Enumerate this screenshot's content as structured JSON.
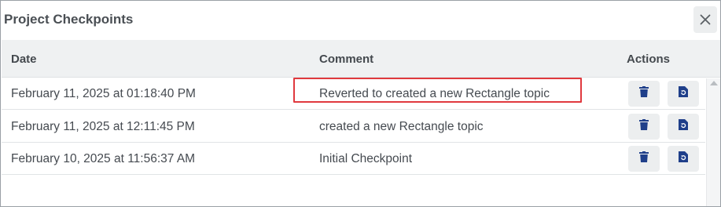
{
  "dialog": {
    "title": "Project Checkpoints",
    "close_icon": "close-icon"
  },
  "table": {
    "headers": {
      "date": "Date",
      "comment": "Comment",
      "actions": "Actions"
    },
    "rows": [
      {
        "date": "February 11, 2025 at 01:18:40 PM",
        "comment": "Reverted to created a new Rectangle topic",
        "highlighted": true
      },
      {
        "date": "February 11, 2025 at 12:11:45 PM",
        "comment": "created a new Rectangle topic",
        "highlighted": false
      },
      {
        "date": "February 10, 2025 at 11:56:37 AM",
        "comment": "Initial Checkpoint",
        "highlighted": false
      }
    ],
    "action_icons": [
      "trash-icon",
      "restore-icon"
    ]
  },
  "colors": {
    "accent": "#1f3f8a",
    "highlight_border": "#e0393e",
    "header_bg": "#eff1f2",
    "button_bg": "#eceeef"
  }
}
